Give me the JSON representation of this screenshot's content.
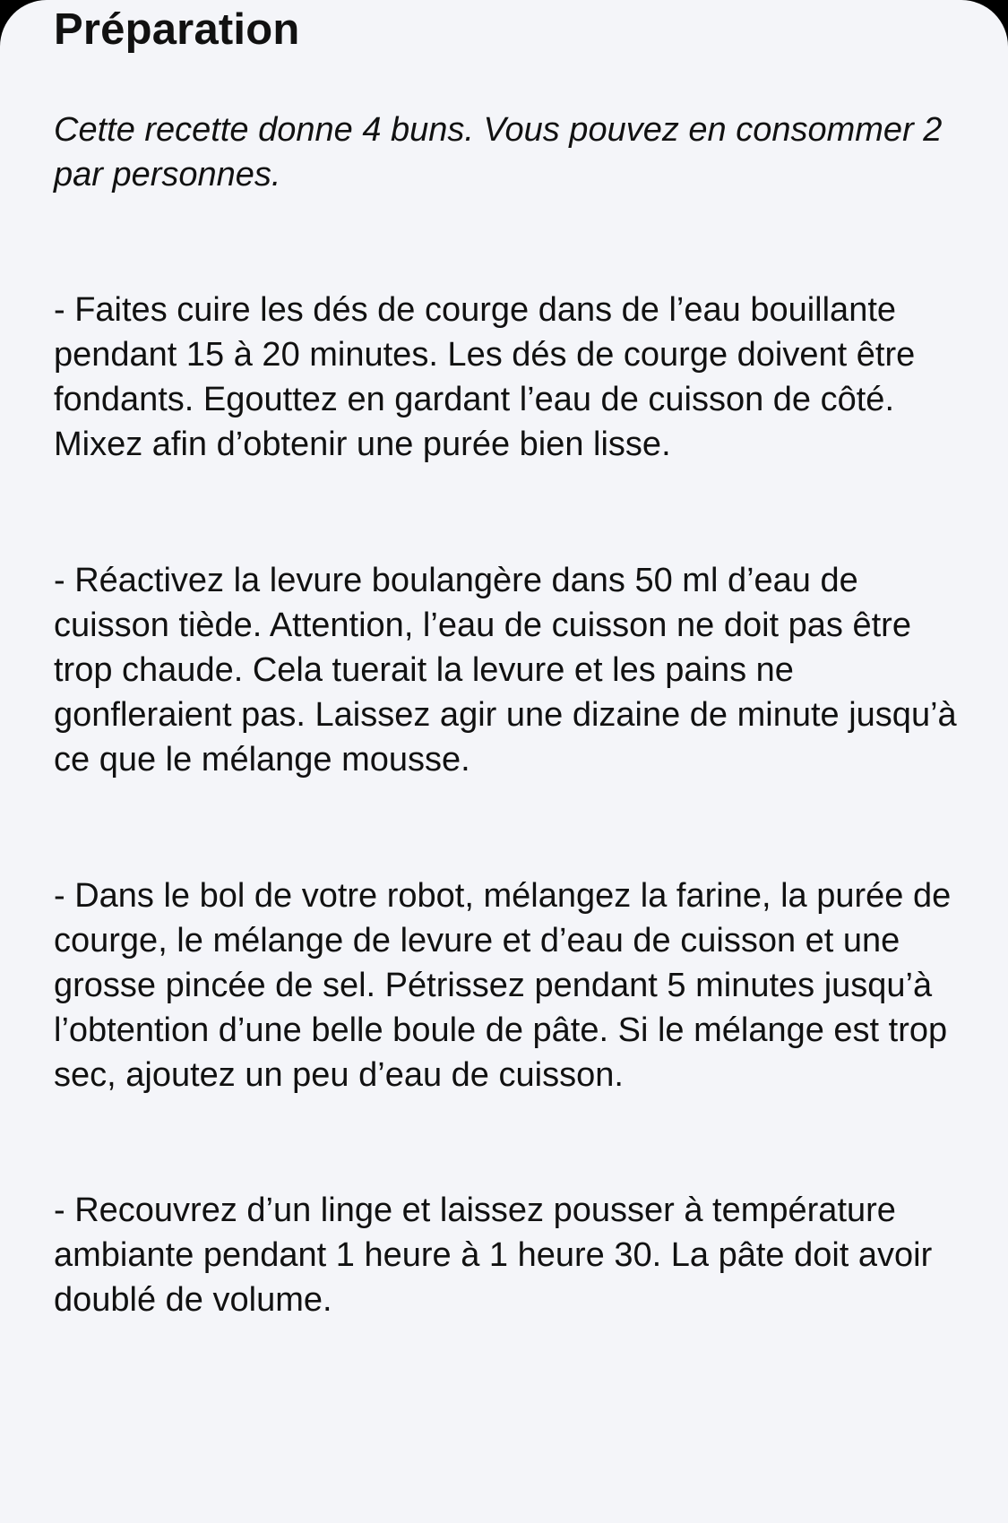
{
  "section": {
    "title": "Préparation",
    "intro": "Cette recette donne 4 buns. Vous pouvez en consommer 2 par personnes.",
    "steps": [
      "- Faites cuire les dés de courge dans de l’eau bouillante pendant 15 à 20 minutes. Les dés de courge doivent être fondants. Egouttez en gardant l’eau de cuisson de côté. Mixez afin d’obtenir une purée bien lisse.",
      "- Réactivez la levure boulangère dans 50 ml d’eau de cuisson tiède. Attention, l’eau de cuisson ne doit pas être trop chaude. Cela tuerait la levure et les pains ne gonfleraient pas. Laissez agir une dizaine de minute jusqu’à ce que le mélange mousse.",
      "- Dans le bol de votre robot, mélangez la farine, la purée de courge, le mélange de levure et d’eau de cuisson et une grosse pincée de sel. Pétrissez pendant 5 minutes jusqu’à l’obtention d’une belle boule de pâte. Si le mélange est trop sec, ajoutez un peu d’eau de cuisson.",
      "- Recouvrez d’un linge et laissez pousser à température ambiante pendant 1 heure à 1 heure 30. La pâte doit avoir doublé de volume."
    ]
  },
  "colors": {
    "background": "#f4f5f9",
    "text": "#111111"
  }
}
